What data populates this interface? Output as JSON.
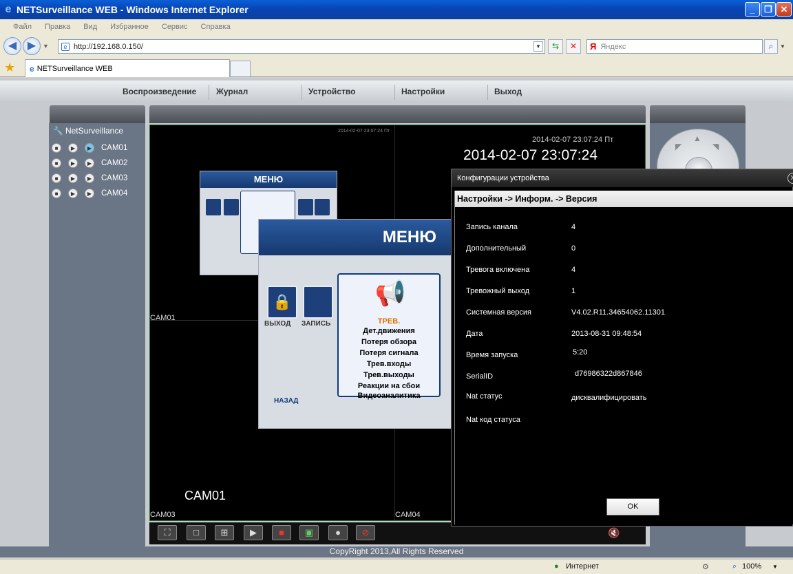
{
  "window": {
    "title": "NETSurveillance WEB - Windows Internet Explorer",
    "minimize": "_",
    "maximize": "❐",
    "close": "✕"
  },
  "menubar": [
    "Файл",
    "Правка",
    "Вид",
    "Избранное",
    "Сервис",
    "Справка"
  ],
  "address": {
    "url": "http://192.168.0.150/",
    "search_placeholder": "Яндекс",
    "search_logo": "Я"
  },
  "tab": {
    "label": "NETSurveillance WEB"
  },
  "nav": {
    "items": [
      "Воспроизведение",
      "Журнал",
      "Устройство",
      "Настройки",
      "Выход"
    ]
  },
  "sidebar": {
    "root": "NetSurveillance",
    "cameras": [
      "CAM01",
      "CAM02",
      "CAM03",
      "CAM04"
    ]
  },
  "video": {
    "tiny_timestamp": "2014-02-07 23:07:24 Пт",
    "timestamp_small": "2014-02-07 23:07:24 Пт",
    "timestamp_large": "2014-02-07 23:07:24",
    "label_cam01_big": "CAM01",
    "label_cam01_tile": "CAM01",
    "label_cam03_tile": "CAM03",
    "label_cam04_tile": "CAM04",
    "menu_title_small": "МЕНЮ",
    "menu_title_large": "МЕНЮ",
    "menu_exit": "ВЫХОД",
    "menu_record": "ЗАПИСЬ",
    "menu_back": "НАЗАД",
    "submenu_heading": "ТРЕВ.",
    "submenu_items": [
      "Дет.движения",
      "Потеря обзора",
      "Потеря сигнала",
      "Трев.входы",
      "Трев.выходы",
      "Реакции на сбои",
      "Видеоаналитика"
    ]
  },
  "dialog": {
    "title": "Конфигурации устройства",
    "breadcrumb": "Настройки -> Информ. -> Версия",
    "rows": [
      {
        "label": "Запись канала",
        "value": "4"
      },
      {
        "label": "Дополнительный",
        "value": "0"
      },
      {
        "label": "Тревога включена",
        "value": "4"
      },
      {
        "label": "Тревожный выход",
        "value": "1"
      },
      {
        "label": "Системная версия",
        "value": "V4.02.R11.34654062.11301"
      },
      {
        "label": "Дата",
        "value": "2013-08-31 09:48:54"
      },
      {
        "label": "Время запуска",
        "value": "5:20"
      },
      {
        "label": "SerialID",
        "value": "d76986322d867846"
      },
      {
        "label": "Nat статус",
        "value": "дисквалифицировать"
      },
      {
        "label": "Nat код статуса",
        "value": ""
      }
    ],
    "ok_label": "OK"
  },
  "footer": {
    "copyright": "CopyRight 2013,All Rights Reserved"
  },
  "statusbar": {
    "zone": "Интернет",
    "zoom": "100%"
  },
  "icons": {
    "ie": "ie-logo-icon",
    "back": "back-arrow-icon",
    "forward": "forward-arrow-icon",
    "refresh": "refresh-icon",
    "stop": "stop-icon",
    "search": "search-icon",
    "favorites": "star-icon"
  },
  "colors": {
    "titlebar": "#0a4fc4",
    "page_bg": "#c7cbcf",
    "panel": "#6a7686",
    "dialog_bg": "#000000"
  }
}
